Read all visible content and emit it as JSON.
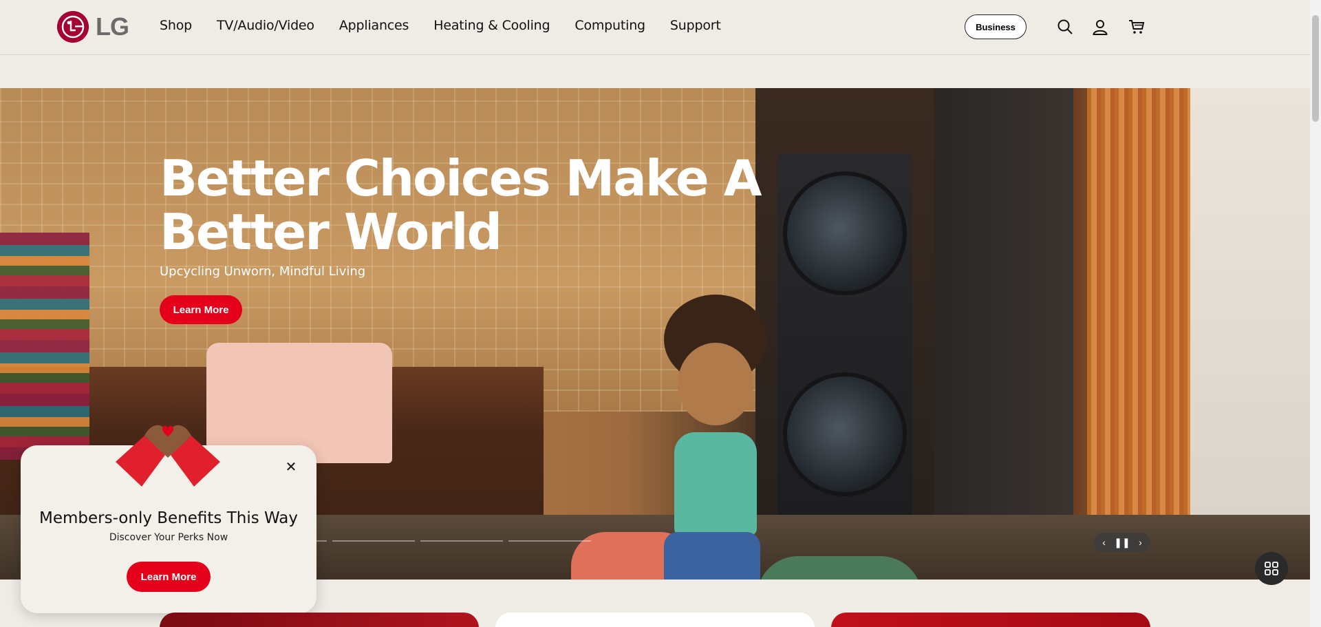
{
  "header": {
    "logo_text": "LG",
    "nav": [
      "Shop",
      "TV/Audio/Video",
      "Appliances",
      "Heating & Cooling",
      "Computing",
      "Support"
    ],
    "business_label": "Business",
    "icons": [
      "search-icon",
      "account-icon",
      "cart-icon"
    ]
  },
  "hero": {
    "title": "Better Choices Make A Better World",
    "subtitle": "Upcycling Unworn, Mindful Living",
    "cta_label": "Learn More",
    "slide_count": 4,
    "controls": [
      "chevron-left-icon",
      "pause-icon",
      "chevron-right-icon"
    ]
  },
  "promo": {
    "title": "Members-only Benefits This Way",
    "subtitle": "Discover Your Perks Now",
    "cta_label": "Learn More"
  },
  "colors": {
    "brand": "#a50034",
    "cta": "#e4001a",
    "background": "#efebe5"
  }
}
